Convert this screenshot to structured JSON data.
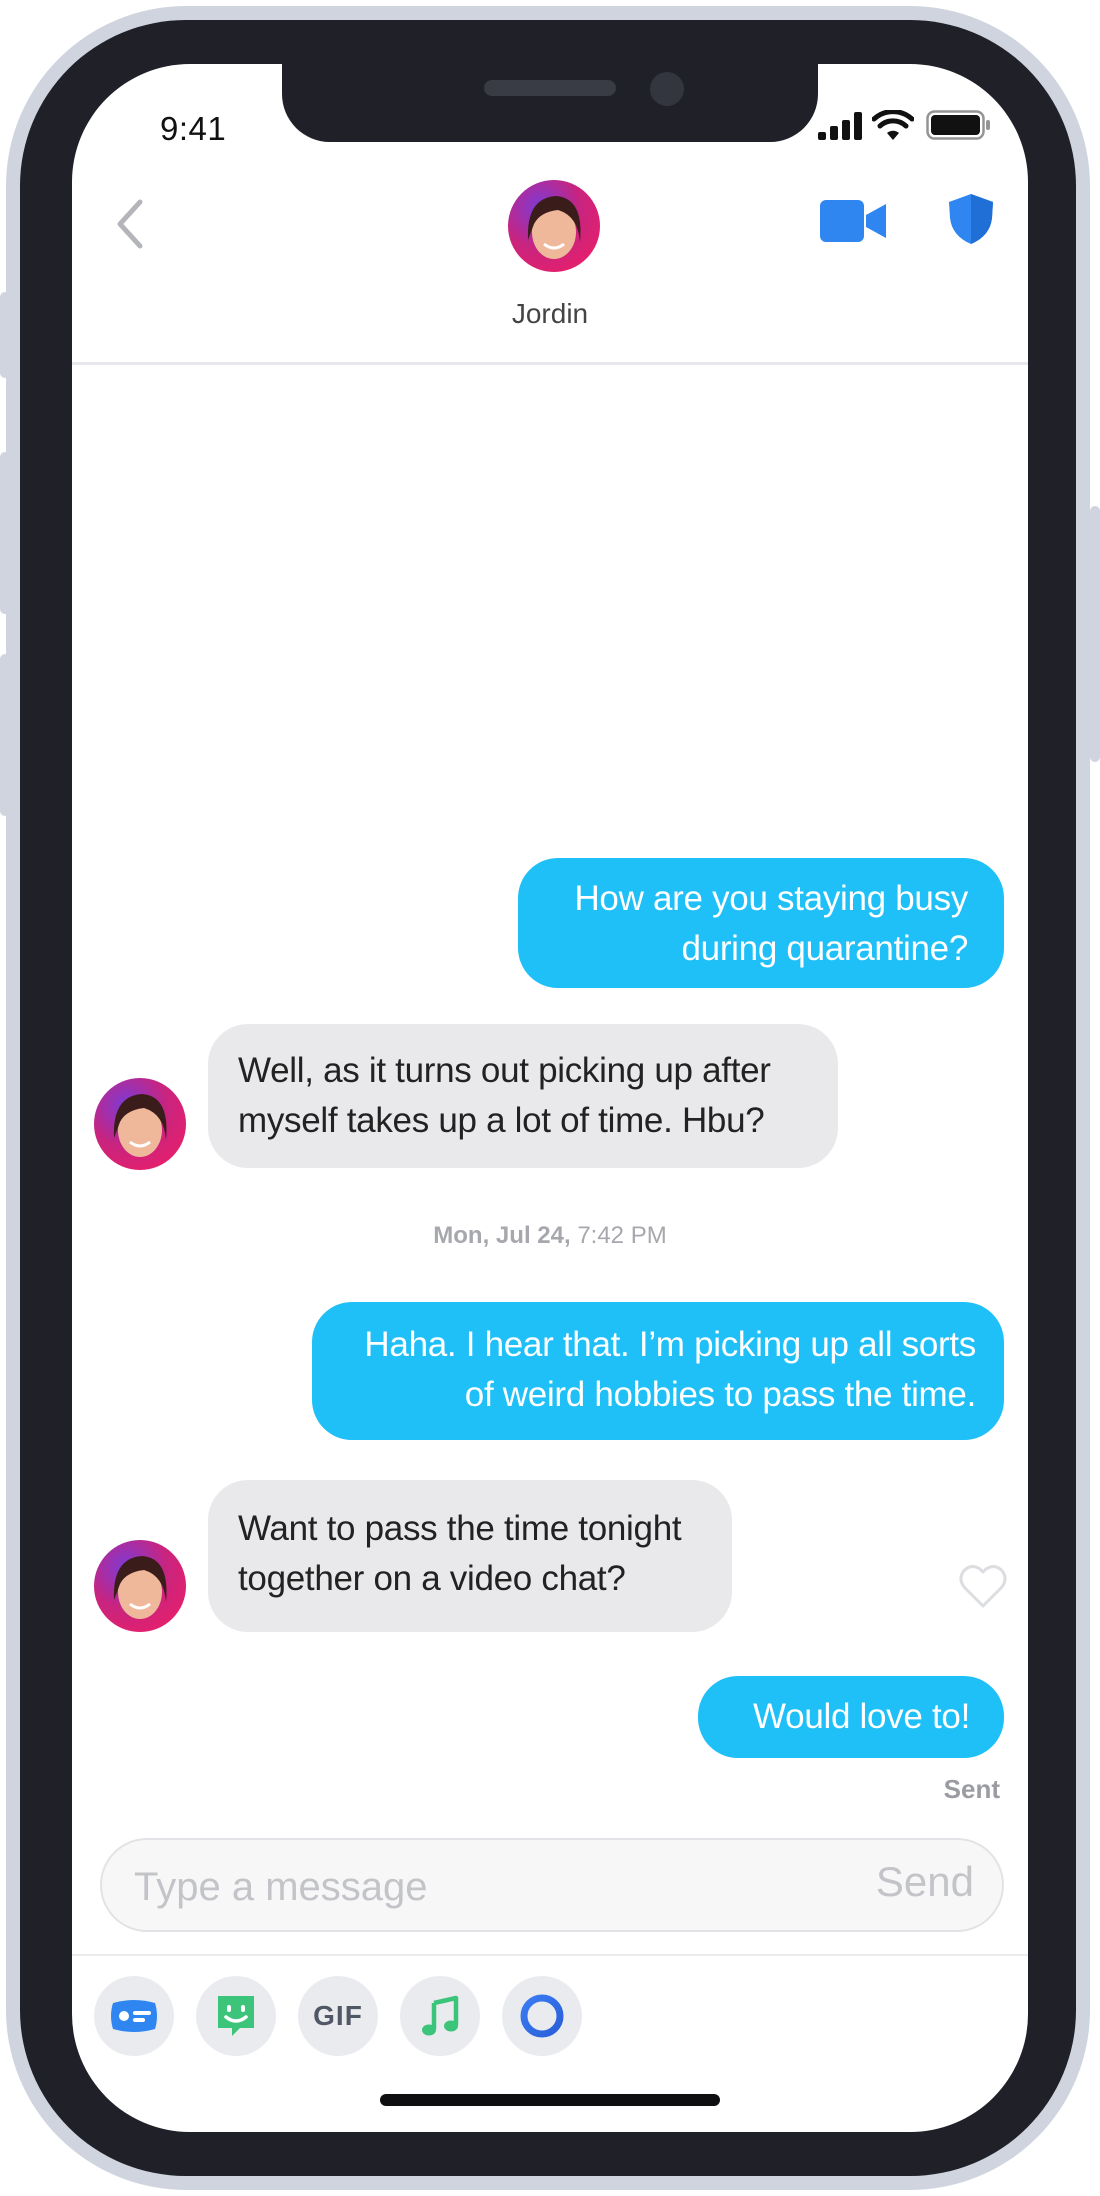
{
  "status_bar": {
    "time": "9:41"
  },
  "header": {
    "contact_name": "Jordin"
  },
  "messages": [
    {
      "direction": "outgoing",
      "lines": [
        "How are you staying busy",
        "during quarantine?"
      ]
    },
    {
      "direction": "incoming",
      "lines": [
        "Well, as it turns out picking up after",
        "myself takes up a lot of time. Hbu?"
      ]
    },
    {
      "direction": "outgoing",
      "lines": [
        "Haha. I hear that. I’m picking up all sorts",
        "of weird hobbies to pass the time."
      ]
    },
    {
      "direction": "incoming",
      "lines": [
        "Want to pass the time tonight",
        "together on a video chat?"
      ]
    },
    {
      "direction": "outgoing",
      "lines": [
        "Would love to!"
      ]
    }
  ],
  "timestamp": {
    "date": "Mon, Jul 24,",
    "time": "7:42 PM"
  },
  "delivery_status": "Sent",
  "composer": {
    "placeholder": "Type a message",
    "send_label": "Send"
  },
  "toolbar": {
    "gif_label": "GIF"
  },
  "icons": [
    "back-chevron-icon",
    "video-camera-icon",
    "shield-icon",
    "heart-icon",
    "contact-card-icon",
    "sticker-icon",
    "music-note-icon",
    "loop-icon"
  ],
  "colors": {
    "accent": "#1ec0f7",
    "incoming_bubble": "#e9e9eb",
    "icon_blue": "#2f86f0",
    "green": "#3bc47a"
  }
}
